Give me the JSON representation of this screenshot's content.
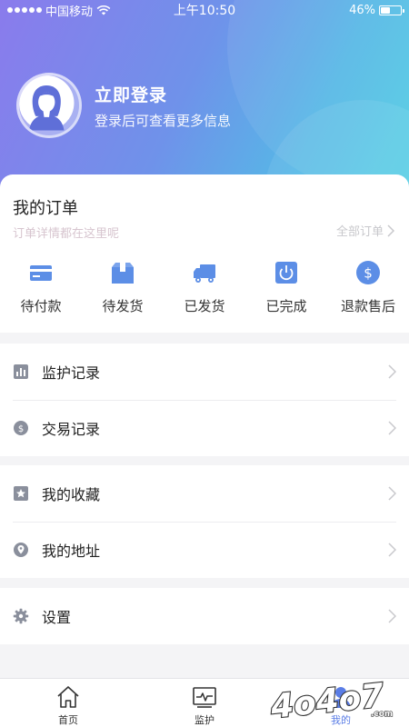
{
  "status_bar": {
    "carrier": "中国移动",
    "time": "上午10:50",
    "battery": "46%",
    "battery_level": 0.46
  },
  "profile": {
    "login_title": "立即登录",
    "login_subtitle": "登录后可查看更多信息"
  },
  "orders": {
    "title": "我的订单",
    "subtitle": "订单详情都在这里呢",
    "all_link": "全部订单",
    "items": [
      {
        "label": "待付款",
        "icon": "card-icon"
      },
      {
        "label": "待发货",
        "icon": "package-icon"
      },
      {
        "label": "已发货",
        "icon": "truck-icon"
      },
      {
        "label": "已完成",
        "icon": "power-icon"
      },
      {
        "label": "退款售后",
        "icon": "yen-coin-icon"
      }
    ]
  },
  "menu": {
    "monitor_records": "监护记录",
    "transaction_records": "交易记录",
    "favorites": "我的收藏",
    "address": "我的地址",
    "settings": "设置"
  },
  "tabs": [
    {
      "label": "首页",
      "icon": "home-icon"
    },
    {
      "label": "监护",
      "icon": "monitor-icon"
    },
    {
      "label": "我的",
      "icon": "user-icon"
    }
  ],
  "watermark": {
    "text": "4o4o7.com"
  },
  "colors": {
    "accent": "#5a7de6",
    "icon_blue": "#5c8ee6",
    "icon_gray": "#8a8f9c",
    "gradient_start": "#8a7bec",
    "gradient_end": "#4fcfe3"
  }
}
